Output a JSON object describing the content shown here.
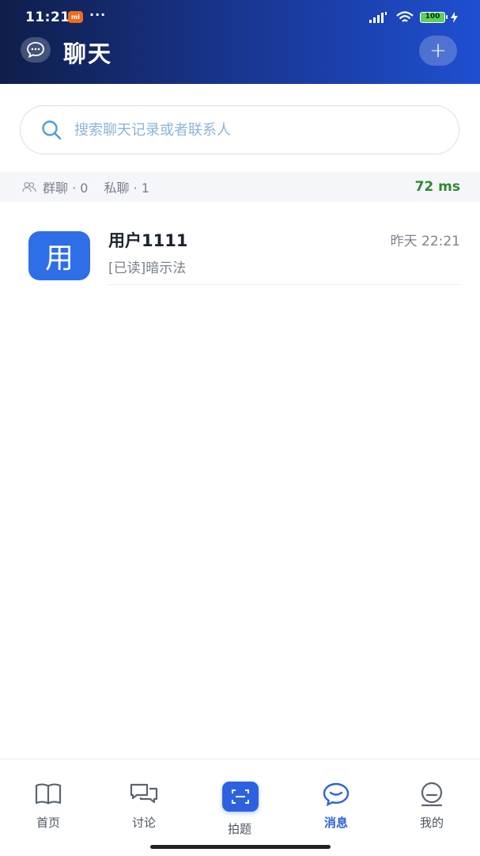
{
  "status_bar": {
    "time": "11:21",
    "mi_badge": "mi",
    "dots": "···",
    "battery": "100",
    "icons": [
      "signal-icon",
      "wifi-icon",
      "battery-icon",
      "charging-icon"
    ]
  },
  "header": {
    "title": "聊天",
    "icons": {
      "left": "chat-bubble-icon",
      "right": "plus-icon"
    },
    "add_label": "+"
  },
  "search": {
    "placeholder": "搜索聊天记录或者联系人",
    "value": ""
  },
  "stats": {
    "group_label": "群聊 · 0",
    "private_label": "私聊 · 1",
    "latency": "72 ms",
    "latency_color": "#2d8a2d"
  },
  "chats": [
    {
      "avatar_text": "用",
      "avatar_color": "#2e6ee6",
      "name": "用户1111",
      "time": "昨天 22:21",
      "preview": "[已读]暗示法"
    }
  ],
  "bottom_nav": {
    "items": [
      {
        "label": "首页",
        "icon": "book-icon",
        "active": false
      },
      {
        "label": "讨论",
        "icon": "discussion-icon",
        "active": false
      },
      {
        "label": "拍题",
        "icon": "scan-icon",
        "active": false
      },
      {
        "label": "消息",
        "icon": "message-icon",
        "active": true
      },
      {
        "label": "我的",
        "icon": "profile-icon",
        "active": false
      }
    ]
  },
  "colors": {
    "accent": "#2c62e0",
    "header_gradient_start": "#0f1e4a",
    "header_gradient_end": "#1f4fd1"
  }
}
